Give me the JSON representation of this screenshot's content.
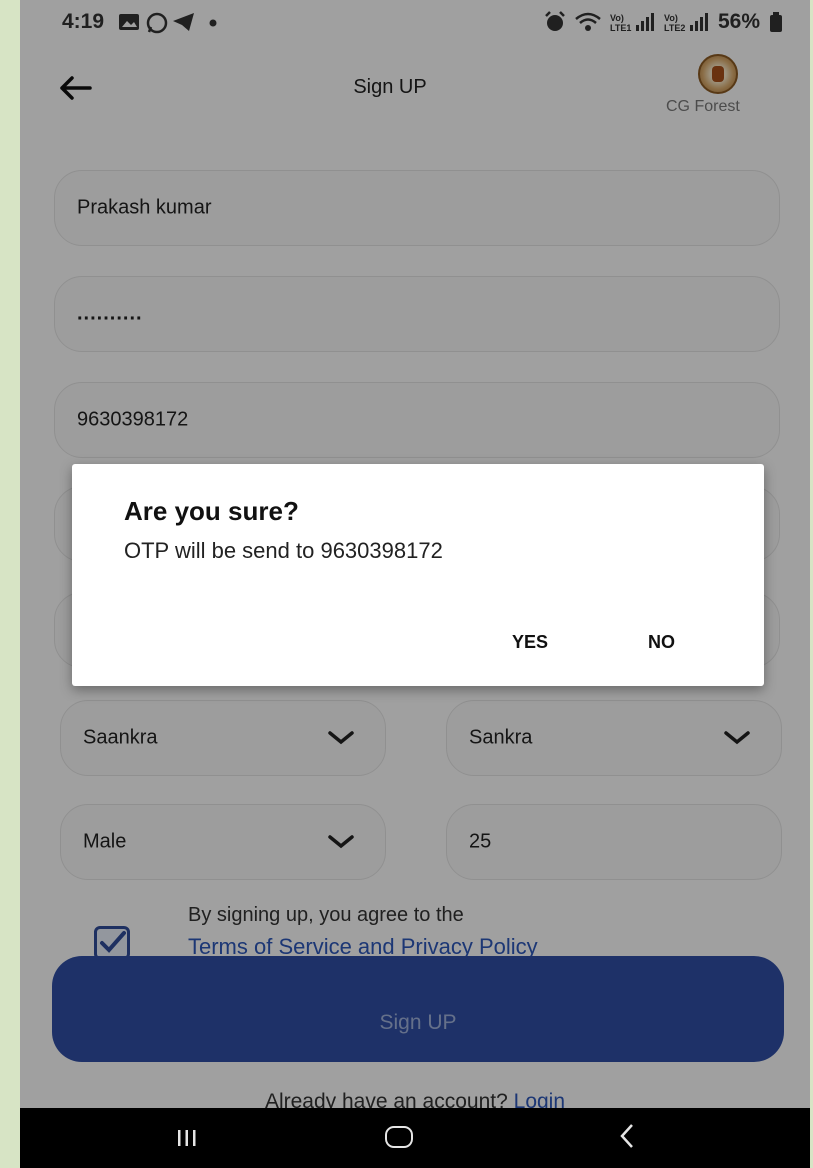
{
  "status_bar": {
    "time": "4:19",
    "battery": "56%"
  },
  "header": {
    "title": "Sign UP",
    "logo_text": "CG Forest"
  },
  "form": {
    "name": "Prakash kumar",
    "password": "..........",
    "phone": "9630398172",
    "dropdown_left": "Saankra",
    "dropdown_right": "Sankra",
    "gender": "Male",
    "age": "25",
    "terms_text": "By signing up, you agree to the",
    "terms_link": "Terms of Service and Privacy Policy",
    "signup_label": "Sign UP",
    "login_prompt": "Already have an account?",
    "login_link": "Login"
  },
  "dialog": {
    "title": "Are you sure?",
    "message": "OTP will be send to 9630398172",
    "yes_label": "YES",
    "no_label": "NO"
  },
  "colors": {
    "primary": "#2f4ea3",
    "link": "#2d56b8",
    "frame": "#d7e4c5"
  }
}
